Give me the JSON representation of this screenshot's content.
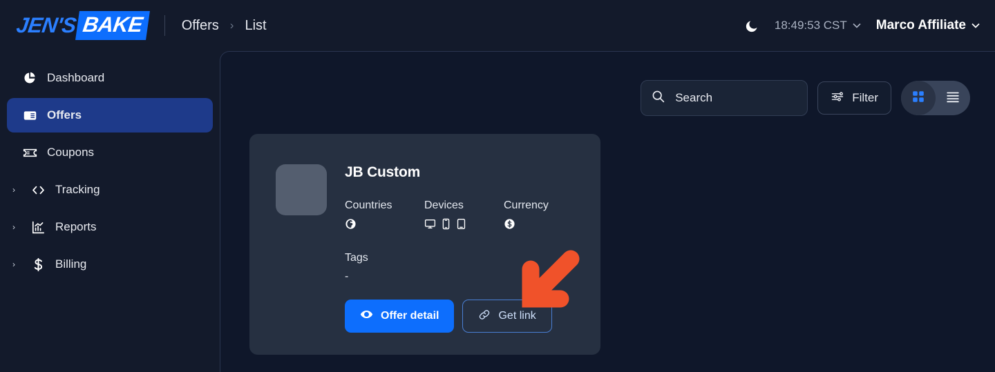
{
  "brand": {
    "name_part1": "JEN'S",
    "name_part2": "BAKE",
    "accent": "#0d6efd"
  },
  "breadcrumb": {
    "items": [
      "Offers",
      "List"
    ],
    "separator": "›"
  },
  "header": {
    "theme_icon": "moon-icon",
    "time": "18:49:53 CST",
    "time_chevron": "⌄",
    "user": "Marco Affiliate",
    "user_chevron": "⌄"
  },
  "sidebar": {
    "items": [
      {
        "label": "Dashboard",
        "icon": "pie-chart-icon",
        "active": false,
        "expandable": false
      },
      {
        "label": "Offers",
        "icon": "offers-list-icon",
        "active": true,
        "expandable": false
      },
      {
        "label": "Coupons",
        "icon": "ticket-icon",
        "active": false,
        "expandable": false
      },
      {
        "label": "Tracking",
        "icon": "code-icon",
        "active": false,
        "expandable": true
      },
      {
        "label": "Reports",
        "icon": "bar-chart-icon",
        "active": false,
        "expandable": true
      },
      {
        "label": "Billing",
        "icon": "dollar-icon",
        "active": false,
        "expandable": true
      }
    ],
    "expand_chevron": "›"
  },
  "toolbar": {
    "search_placeholder": "Search",
    "search_value": "",
    "search_icon": "search-icon",
    "filter_label": "Filter",
    "filter_icon": "sliders-icon",
    "view_grid_icon": "grid-view-icon",
    "view_list_icon": "list-view-icon",
    "view_active": "grid"
  },
  "offer_card": {
    "title": "JB Custom",
    "thumbnail": "offer-thumbnail-placeholder",
    "meta": [
      {
        "label": "Countries",
        "icons": [
          "globe-icon"
        ]
      },
      {
        "label": "Devices",
        "icons": [
          "desktop-icon",
          "mobile-icon",
          "tablet-icon"
        ]
      },
      {
        "label": "Currency",
        "icons": [
          "dollar-circle-icon"
        ]
      }
    ],
    "tags_label": "Tags",
    "tags_value": "-",
    "buttons": {
      "detail_label": "Offer detail",
      "detail_icon": "eye-icon",
      "link_label": "Get link",
      "link_icon": "chain-link-icon"
    }
  },
  "annotation": {
    "arrow_color": "#f0522a",
    "arrow_direction": "down-left",
    "points_at": "Get link"
  }
}
